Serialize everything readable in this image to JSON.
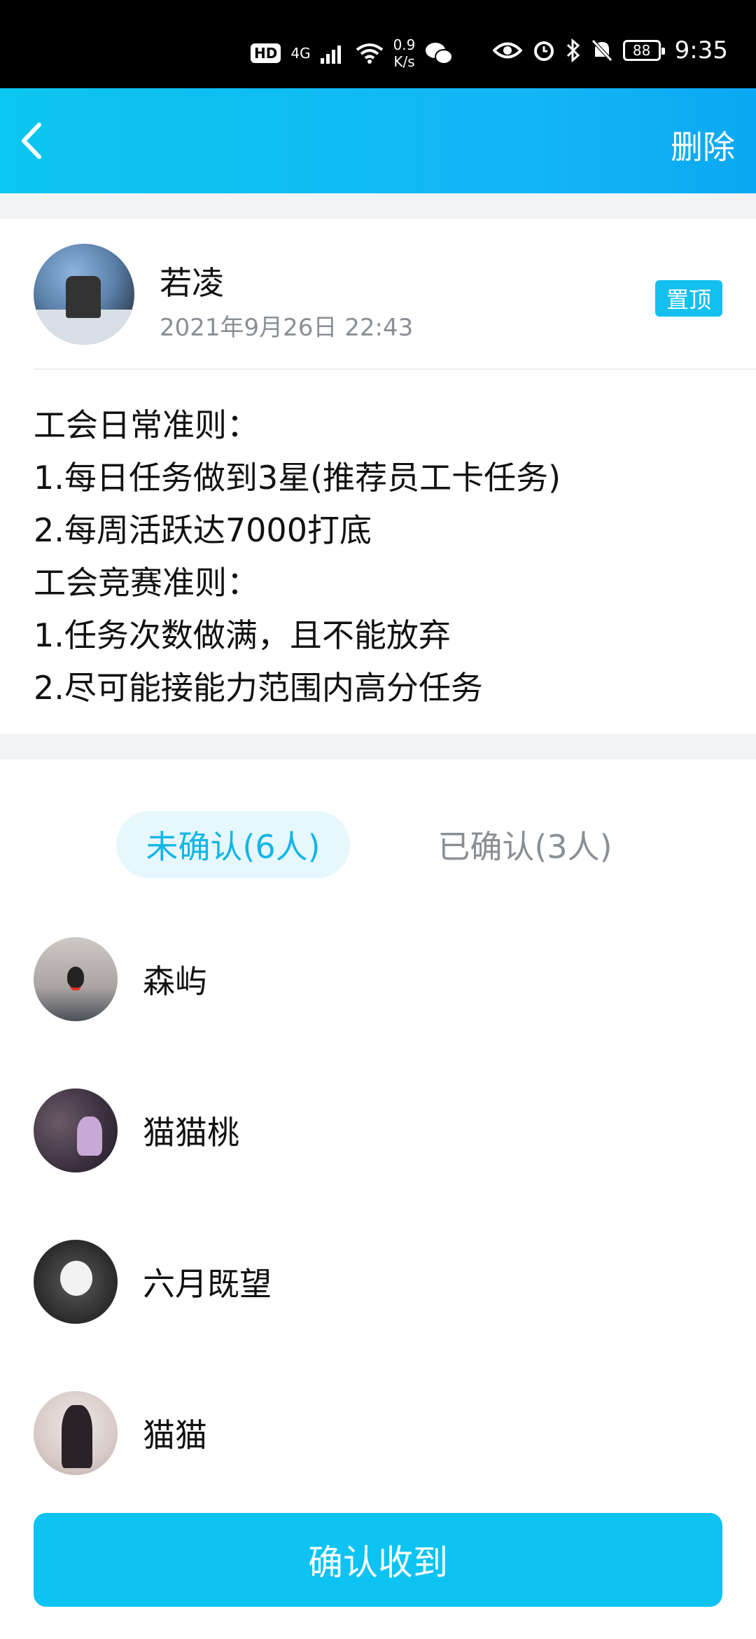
{
  "status_bar": {
    "hd": "HD",
    "network": "4G",
    "speed_value": "0.9",
    "speed_unit": "K/s",
    "battery": "88",
    "time": "9:35"
  },
  "header": {
    "delete_label": "删除"
  },
  "post": {
    "author_name": "若凌",
    "timestamp": "2021年9月26日 22:43",
    "pin_label": "置顶",
    "lines": [
      "工会日常准则：",
      "1.每日任务做到3星(推荐员工卡任务)",
      "2.每周活跃达7000打底",
      "工会竞赛准则：",
      "1.任务次数做满，且不能放弃",
      "2.尽可能接能力范围内高分任务"
    ]
  },
  "tabs": {
    "unconfirmed": "未确认(6人)",
    "confirmed": "已确认(3人)"
  },
  "members": [
    {
      "name": "森屿"
    },
    {
      "name": "猫猫桃"
    },
    {
      "name": "六月既望"
    },
    {
      "name": "猫猫"
    }
  ],
  "confirm_button": "确认收到",
  "colors": {
    "accent": "#13b6f6",
    "tab_active_bg": "#e6f8fd",
    "button": "#0cc3f2"
  }
}
